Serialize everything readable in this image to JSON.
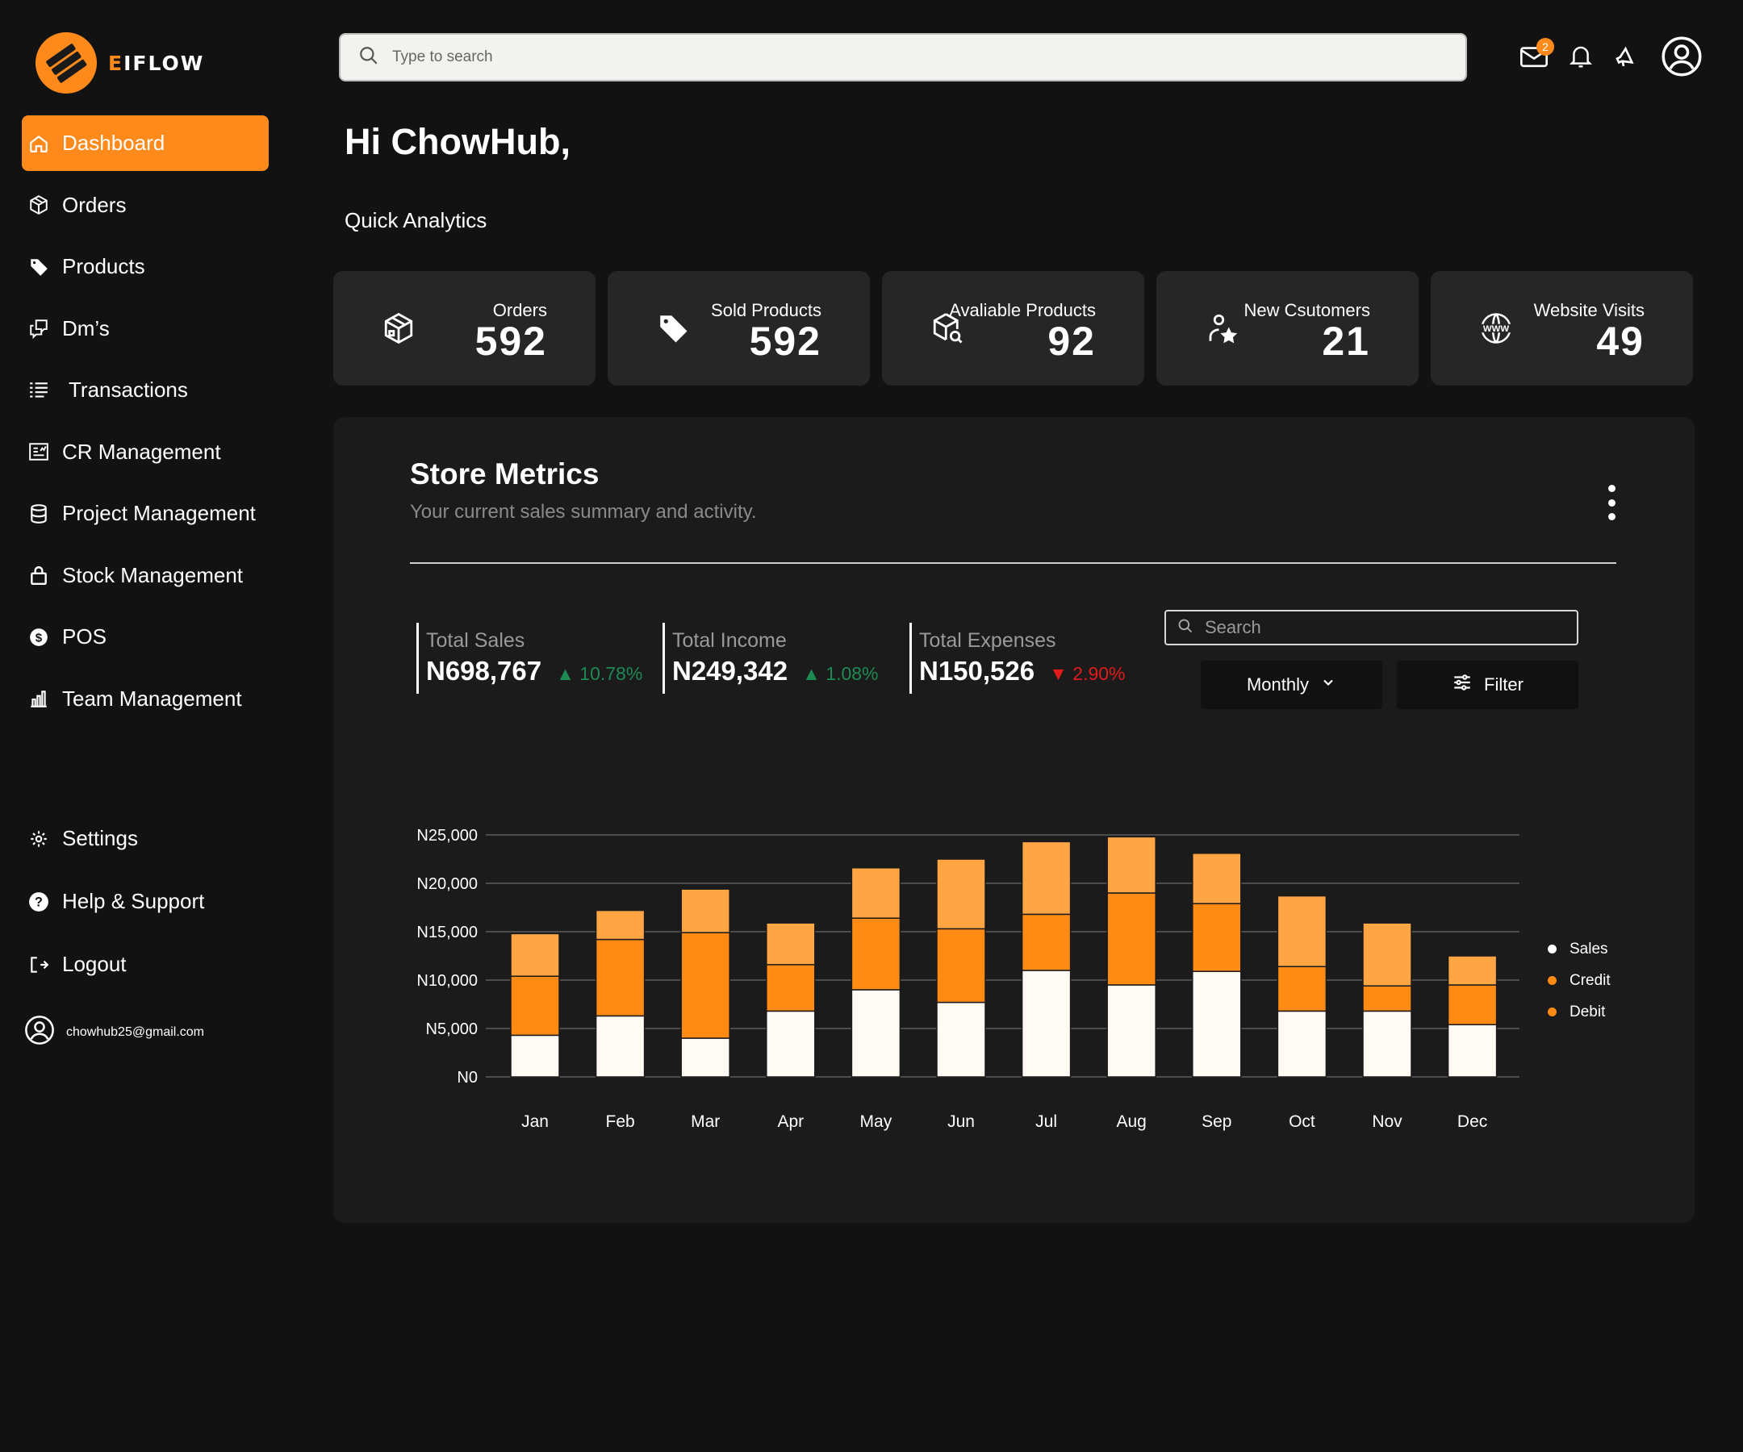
{
  "app": {
    "logo_first": "E",
    "logo_rest": "IFLOW"
  },
  "search": {
    "placeholder": "Type to search"
  },
  "notifications": {
    "mail_count": "2"
  },
  "sidebar": {
    "items": [
      {
        "label": "Dashboard",
        "icon": "home-icon"
      },
      {
        "label": "Orders",
        "icon": "box-icon"
      },
      {
        "label": "Products",
        "icon": "tag-icon"
      },
      {
        "label": "Dm’s",
        "icon": "chat-icon"
      },
      {
        "label": "Transactions",
        "icon": "list-icon"
      },
      {
        "label": "CR Management",
        "icon": "crm-icon"
      },
      {
        "label": "Project Management",
        "icon": "database-icon"
      },
      {
        "label": "Stock Management",
        "icon": "lock-icon"
      },
      {
        "label": "POS",
        "icon": "coin-icon"
      },
      {
        "label": "Team Management",
        "icon": "bar-chart-icon"
      }
    ],
    "bottom": [
      {
        "label": "Settings",
        "icon": "gear-icon"
      },
      {
        "label": "Help & Support",
        "icon": "help-icon"
      },
      {
        "label": "Logout",
        "icon": "logout-icon"
      }
    ],
    "email": "chowhub25@gmail.com"
  },
  "greeting": "Hi ChowHub,",
  "quick_analytics": "Quick Analytics",
  "cards": [
    {
      "label": "Orders",
      "value": "592",
      "icon": "box-icon"
    },
    {
      "label": "Sold Products",
      "value": "592",
      "icon": "tag-icon"
    },
    {
      "label": "Avaliable Products",
      "value": "92",
      "icon": "package-search-icon"
    },
    {
      "label": "New Csutomers",
      "value": "21",
      "icon": "user-star-icon"
    },
    {
      "label": "Website Visits",
      "value": "49",
      "icon": "globe-www-icon"
    }
  ],
  "metrics": {
    "title": "Store Metrics",
    "subtitle": "Your current sales summary and activity.",
    "kpis": [
      {
        "label": "Total Sales",
        "value": "N698,767",
        "change": "▲ 10.78%",
        "direction": "up"
      },
      {
        "label": "Total Income",
        "value": "N249,342",
        "change": "▲ 1.08%",
        "direction": "up"
      },
      {
        "label": "Total Expenses",
        "value": "N150,526",
        "change": "▼ 2.90%",
        "direction": "down"
      }
    ],
    "search_placeholder": "Search",
    "period": "Monthly",
    "filter_label": "Filter"
  },
  "colors": {
    "accent": "#ff8a1c",
    "sales": "#fffaf3",
    "credit": "#ff8a14",
    "debit": "#ffa544",
    "up": "#1d8a54",
    "down": "#e01b1b"
  },
  "chart_data": {
    "type": "bar",
    "stacked": true,
    "categories": [
      "Jan",
      "Feb",
      "Mar",
      "Apr",
      "May",
      "Jun",
      "Jul",
      "Aug",
      "Sep",
      "Oct",
      "Nov",
      "Dec"
    ],
    "series": [
      {
        "name": "Sales",
        "color": "#fffaf3",
        "values": [
          4300,
          6300,
          4000,
          6800,
          9000,
          7700,
          11000,
          9500,
          10900,
          6800,
          6800,
          5400
        ]
      },
      {
        "name": "Credit",
        "color": "#ff8a14",
        "values": [
          6100,
          7900,
          10900,
          4800,
          7400,
          7600,
          5800,
          9500,
          7000,
          4600,
          2600,
          4100
        ]
      },
      {
        "name": "Debit",
        "color": "#ffa544",
        "values": [
          4400,
          3000,
          4500,
          4300,
          5200,
          7200,
          7500,
          5800,
          5200,
          7300,
          6500,
          3000
        ]
      }
    ],
    "yticks": [
      "N0",
      "N5,000",
      "N10,000",
      "N15,000",
      "N20,000",
      "N25,000"
    ],
    "ylim": [
      0,
      25000
    ],
    "grid": true,
    "legend": "right"
  }
}
